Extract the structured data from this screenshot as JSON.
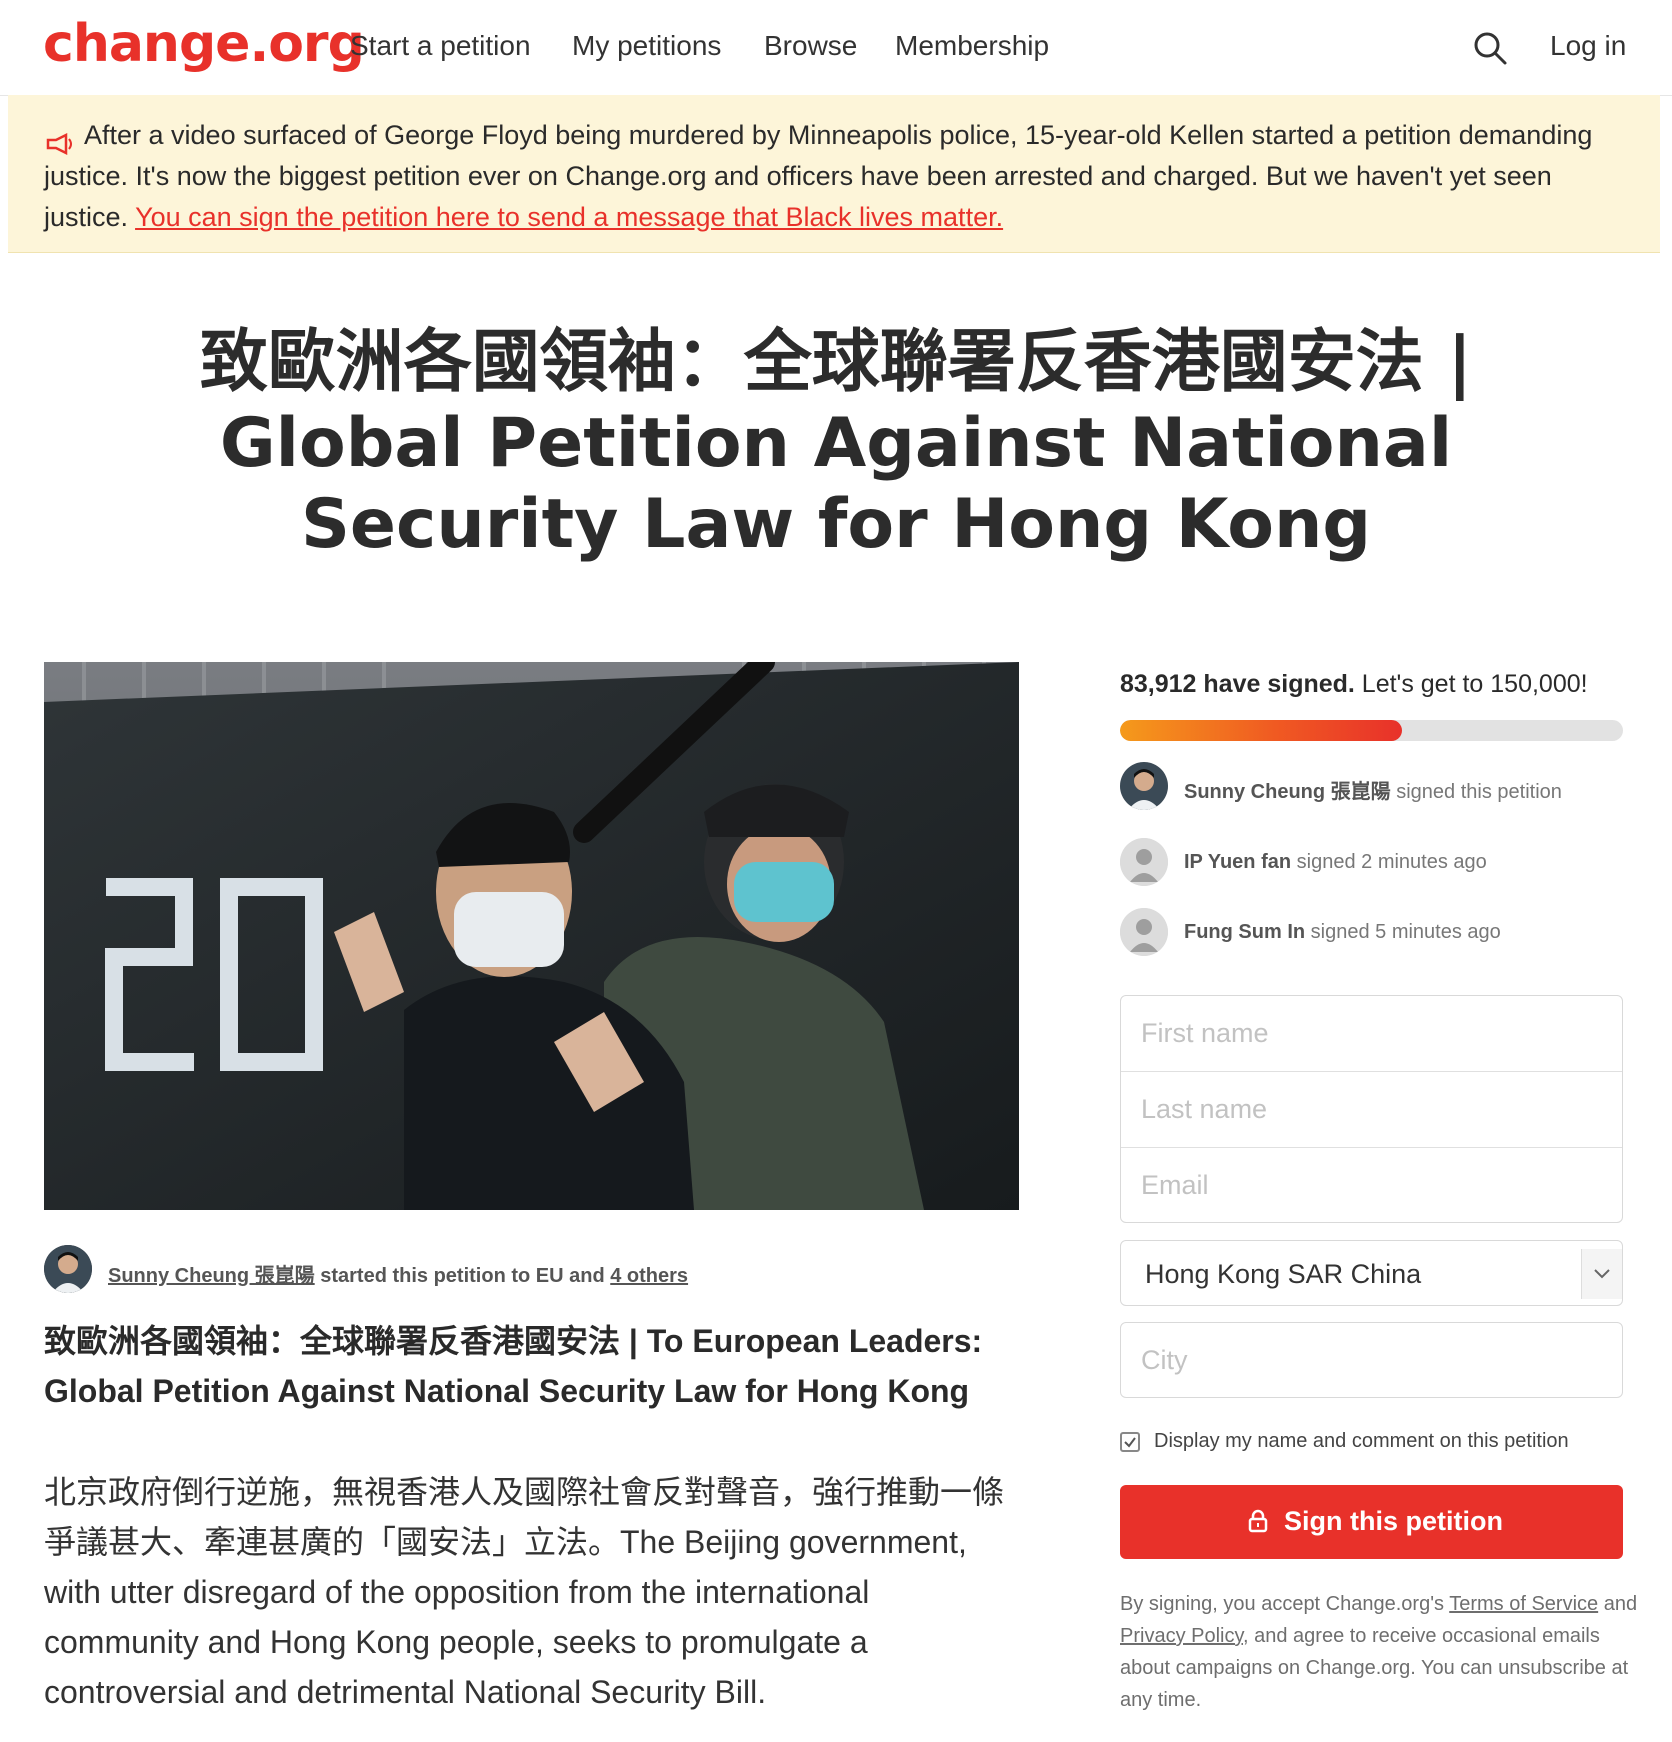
{
  "header": {
    "logo": "change.org",
    "nav": [
      "Start a petition",
      "My petitions",
      "Browse",
      "Membership"
    ],
    "login": "Log in",
    "search_icon": "search-icon"
  },
  "banner": {
    "icon": "megaphone-icon",
    "text": "After a video surfaced of George Floyd being murdered by Minneapolis police, 15-year-old Kellen started a petition demanding justice. It's now the biggest petition ever on Change.org and officers have been arrested and charged. But we haven't yet seen justice.",
    "link": "You can sign the petition here to send a message that Black lives matter."
  },
  "petition": {
    "title": "致歐洲各國領袖：全球聯署反香港國安法 | Global Petition Against National Security Law for Hong Kong",
    "starter_name": "Sunny Cheung 張崑陽",
    "starter_mid": " started this petition to EU and ",
    "starter_others": "4 others",
    "subtitle": "致歐洲各國領袖：全球聯署反香港國安法 | To European Leaders: Global Petition Against National Security Law for Hong Kong",
    "body": "北京政府倒行逆施，無視香港人及國際社會反對聲音，強行推動一條爭議甚大、牽連甚廣的「國安法」立法。The Beijing government, with utter disregard of the opposition from the international community and Hong Kong people, seeks to promulgate a controversial and detrimental National Security Bill."
  },
  "signatures": {
    "count_text": "83,912 have signed.",
    "goal_text": " Let's get to 150,000!",
    "progress_fraction": 0.56,
    "recent": [
      {
        "name": "Sunny Cheung 張崑陽",
        "action": " signed this petition"
      },
      {
        "name": "IP Yuen fan",
        "action": " signed 2 minutes ago"
      },
      {
        "name": "Fung Sum In",
        "action": " signed 5 minutes ago"
      }
    ]
  },
  "form": {
    "first_name_placeholder": "First name",
    "last_name_placeholder": "Last name",
    "email_placeholder": "Email",
    "country": "Hong Kong SAR China",
    "city_placeholder": "City",
    "display_label": "Display my name and comment on this petition",
    "sign_button": "Sign this petition"
  },
  "legal": {
    "pre": "By signing, you accept Change.org's ",
    "terms": "Terms of Service",
    "and": " and ",
    "privacy": "Privacy Policy",
    "post": ", and agree to receive occasional emails about campaigns on Change.org. You can unsubscribe at any time."
  },
  "colors": {
    "brand_red": "#e8312a",
    "banner_bg": "#fdf5d9",
    "progress_start": "#f59a1b",
    "progress_end": "#e8312a"
  }
}
